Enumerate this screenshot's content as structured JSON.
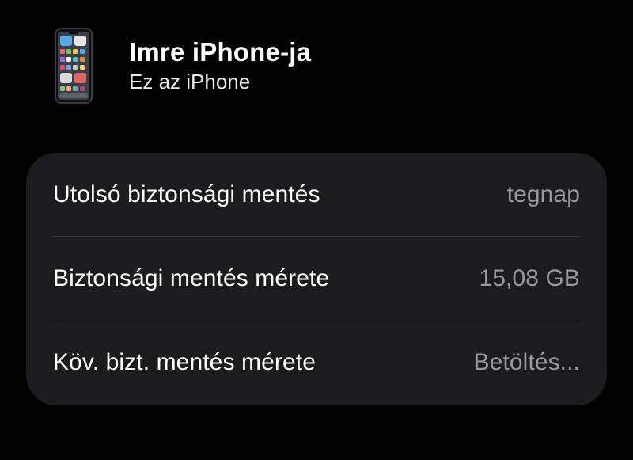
{
  "device": {
    "name": "Imre iPhone-ja",
    "subtitle": "Ez az iPhone",
    "icon": "iphone-icon"
  },
  "backup": {
    "rows": [
      {
        "label": "Utolsó biztonsági mentés",
        "value": "tegnap"
      },
      {
        "label": "Biztonsági mentés mérete",
        "value": "15,08 GB"
      },
      {
        "label": "Köv. bizt. mentés mérete",
        "value": "Betöltés..."
      }
    ]
  },
  "colors": {
    "background": "#000000",
    "card": "#1c1c1e",
    "primary_text": "#ffffff",
    "secondary_text": "#98989e",
    "separator": "#3a3a3c"
  }
}
